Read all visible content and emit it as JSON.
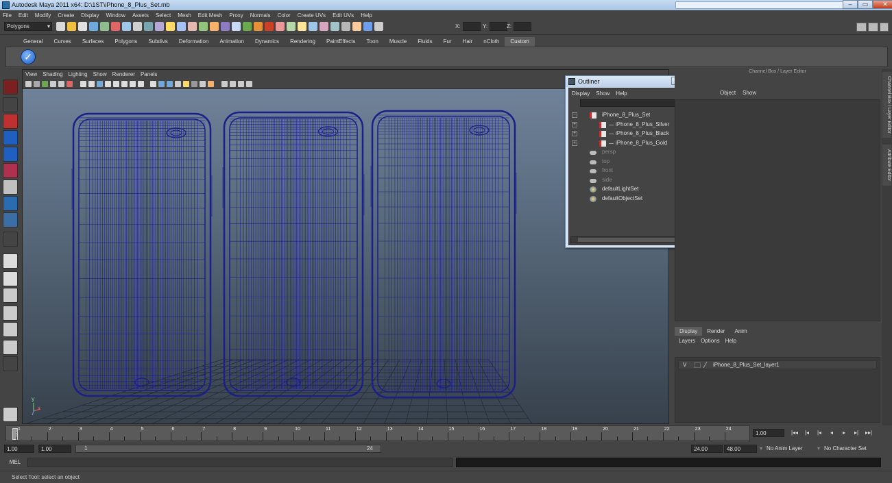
{
  "window": {
    "title": "Autodesk Maya 2011 x64: D:\\1ST\\iPhone_8_Plus_Set.mb"
  },
  "menubar": [
    "File",
    "Edit",
    "Modify",
    "Create",
    "Display",
    "Window",
    "Assets",
    "Select",
    "Mesh",
    "Edit Mesh",
    "Proxy",
    "Normals",
    "Color",
    "Create UVs",
    "Edit UVs",
    "Help"
  ],
  "status_line": {
    "mode": "Polygons",
    "x_label": "X:",
    "y_label": "Y:",
    "z_label": "Z:"
  },
  "shelf_tabs": [
    "General",
    "Curves",
    "Surfaces",
    "Polygons",
    "Subdivs",
    "Deformation",
    "Animation",
    "Dynamics",
    "Rendering",
    "PaintEffects",
    "Toon",
    "Muscle",
    "Fluids",
    "Fur",
    "Hair",
    "nCloth",
    "Custom"
  ],
  "active_shelf_tab": "Custom",
  "viewport": {
    "menu": [
      "View",
      "Shading",
      "Lighting",
      "Show",
      "Renderer",
      "Panels"
    ],
    "axis_y": "y",
    "axis_x": "x"
  },
  "outliner": {
    "title": "Outliner",
    "menu": [
      "Display",
      "Show",
      "Help"
    ],
    "items": [
      {
        "label": "iPhone_8_Plus_Set",
        "expander": "−",
        "icon": "group-icon",
        "dim": false
      },
      {
        "label": "iPhone_8_Plus_Silver",
        "expander": "+",
        "icon": "group-icon",
        "dim": false
      },
      {
        "label": "iPhone_8_Plus_Black",
        "expander": "+",
        "icon": "group-icon",
        "dim": false
      },
      {
        "label": "iPhone_8_Plus_Gold",
        "expander": "+",
        "icon": "group-icon",
        "dim": false
      },
      {
        "label": "persp",
        "expander": "",
        "icon": "camera-icon",
        "dim": true
      },
      {
        "label": "top",
        "expander": "",
        "icon": "camera-icon",
        "dim": true
      },
      {
        "label": "front",
        "expander": "",
        "icon": "camera-icon",
        "dim": true
      },
      {
        "label": "side",
        "expander": "",
        "icon": "camera-icon",
        "dim": true
      },
      {
        "label": "defaultLightSet",
        "expander": "",
        "icon": "set-icon",
        "dim": false
      },
      {
        "label": "defaultObjectSet",
        "expander": "",
        "icon": "set-icon",
        "dim": false
      }
    ]
  },
  "channel_box": {
    "header": "Channel Box / Layer Editor",
    "menu": [
      "Object",
      "Show"
    ]
  },
  "side_tabs": [
    "Channel Box / Layer Editor",
    "Attribute Editor"
  ],
  "layer_editor": {
    "tabs": [
      "Display",
      "Render",
      "Anim"
    ],
    "menu": [
      "Layers",
      "Options",
      "Help"
    ],
    "layer": {
      "visible": "V",
      "name": "iPhone_8_Plus_Set_layer1"
    }
  },
  "timeline": {
    "ticks": [
      "1",
      "2",
      "3",
      "4",
      "5",
      "6",
      "7",
      "8",
      "9",
      "10",
      "11",
      "12",
      "13",
      "14",
      "15",
      "16",
      "17",
      "18",
      "19",
      "20",
      "21",
      "22",
      "23",
      "24"
    ],
    "current_frame": "1.00",
    "current_marker": "1"
  },
  "range": {
    "start_time": "1.00",
    "start_range": "1.00",
    "slider_start": "1",
    "slider_end": "24",
    "end_range": "24.00",
    "end_time": "48.00",
    "anim_layer": "No Anim Layer",
    "char_set": "No Character Set"
  },
  "command_line": {
    "label": "MEL"
  },
  "help_line": "Select Tool: select an object",
  "colors": {
    "wireframe": "#1c1e8a",
    "viewport_top": "#6e8299",
    "viewport_bottom": "#37414c",
    "ui_bg": "#444444"
  }
}
